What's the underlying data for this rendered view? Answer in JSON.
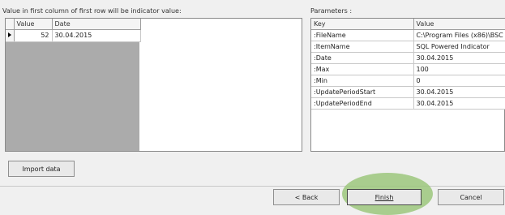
{
  "data_panel": {
    "label": "Value in first column of first row will be indicator value:",
    "columns": [
      "Value",
      "Date"
    ],
    "rows": [
      {
        "value": "52",
        "date": "30.04.2015"
      }
    ],
    "import_button": "Import data"
  },
  "params_panel": {
    "label": "Parameters :",
    "columns": [
      "Key",
      "Value"
    ],
    "rows": [
      {
        "key": ":FileName",
        "value": "C:\\Program Files (x86)\\BSC"
      },
      {
        "key": ":ItemName",
        "value": "SQL Powered Indicator"
      },
      {
        "key": ":Date",
        "value": "30.04.2015"
      },
      {
        "key": ":Max",
        "value": "100"
      },
      {
        "key": ":Min",
        "value": "0"
      },
      {
        "key": ":UpdatePeriodStart",
        "value": "30.04.2015"
      },
      {
        "key": ":UpdatePeriodEnd",
        "value": "30.04.2015"
      }
    ]
  },
  "footer": {
    "back": "< Back",
    "finish": "Finish",
    "cancel": "Cancel"
  },
  "colors": {
    "highlight": "#9cc77d"
  }
}
